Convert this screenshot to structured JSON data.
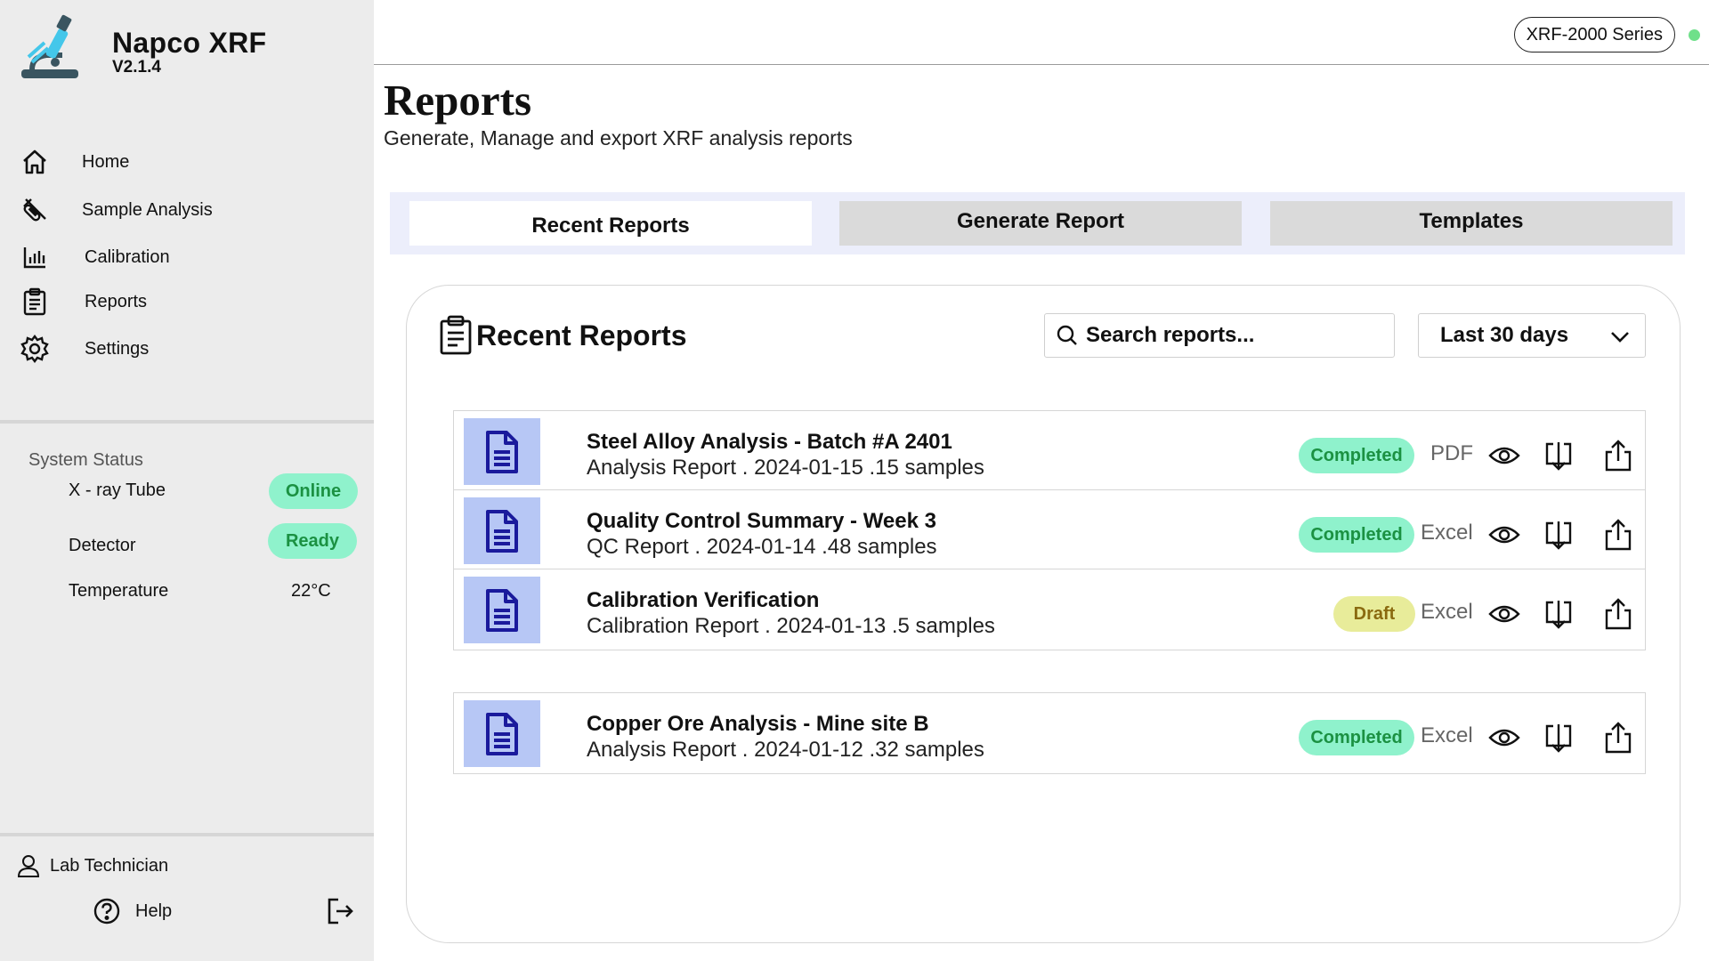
{
  "app": {
    "name": "Napco  XRF",
    "version": "V2.1.4"
  },
  "sidebar": {
    "items": [
      {
        "label": "Home",
        "icon": "home-icon"
      },
      {
        "label": "Sample Analysis",
        "icon": "test-tube-icon"
      },
      {
        "label": "Calibration",
        "icon": "bar-chart-icon"
      },
      {
        "label": "Reports",
        "icon": "clipboard-icon"
      },
      {
        "label": "Settings",
        "icon": "gear-icon"
      }
    ],
    "system_status": {
      "title": "System Status",
      "xray_label": "X - ray Tube",
      "xray_value": "Online",
      "detector_label": "Detector",
      "detector_value": "Ready",
      "temperature_label": "Temperature",
      "temperature_value": "22°C"
    },
    "user": "Lab Technician",
    "help": "Help"
  },
  "topbar": {
    "series": "XRF-2000 Series",
    "connection_color": "#6fe08a"
  },
  "page": {
    "title": "Reports",
    "subtitle": "Generate, Manage and export XRF analysis reports"
  },
  "tabs": [
    {
      "label": "Recent Reports",
      "active": true
    },
    {
      "label": "Generate Report",
      "active": false
    },
    {
      "label": "Templates",
      "active": false
    }
  ],
  "card": {
    "title": "Recent Reports",
    "search_placeholder": "Search reports...",
    "date_filter": "Last 30 days"
  },
  "reports": [
    {
      "title": "Steel Alloy Analysis - Batch #A 2401",
      "meta": "Analysis Report . 2024-01-15 .15 samples",
      "status": "Completed",
      "format": "PDF"
    },
    {
      "title": "Quality Control Summary - Week 3",
      "meta": "QC Report . 2024-01-14 .48 samples",
      "status": "Completed",
      "format": "Excel"
    },
    {
      "title": "Calibration Verification",
      "meta": "Calibration Report . 2024-01-13 .5 samples",
      "status": "Draft",
      "format": "Excel"
    },
    {
      "title": "Copper Ore Analysis - Mine site B",
      "meta": "Analysis Report . 2024-01-12 .32 samples",
      "status": "Completed",
      "format": "Excel"
    }
  ],
  "colors": {
    "accent_tab_bg": "#eceefb",
    "completed_bg": "#8ff2cc",
    "completed_text": "#1b9142",
    "draft_bg": "#e8ec9a",
    "draft_text": "#8a6a10",
    "doc_thumb_bg": "#b7c7f5",
    "doc_icon": "#1a1a9c"
  }
}
